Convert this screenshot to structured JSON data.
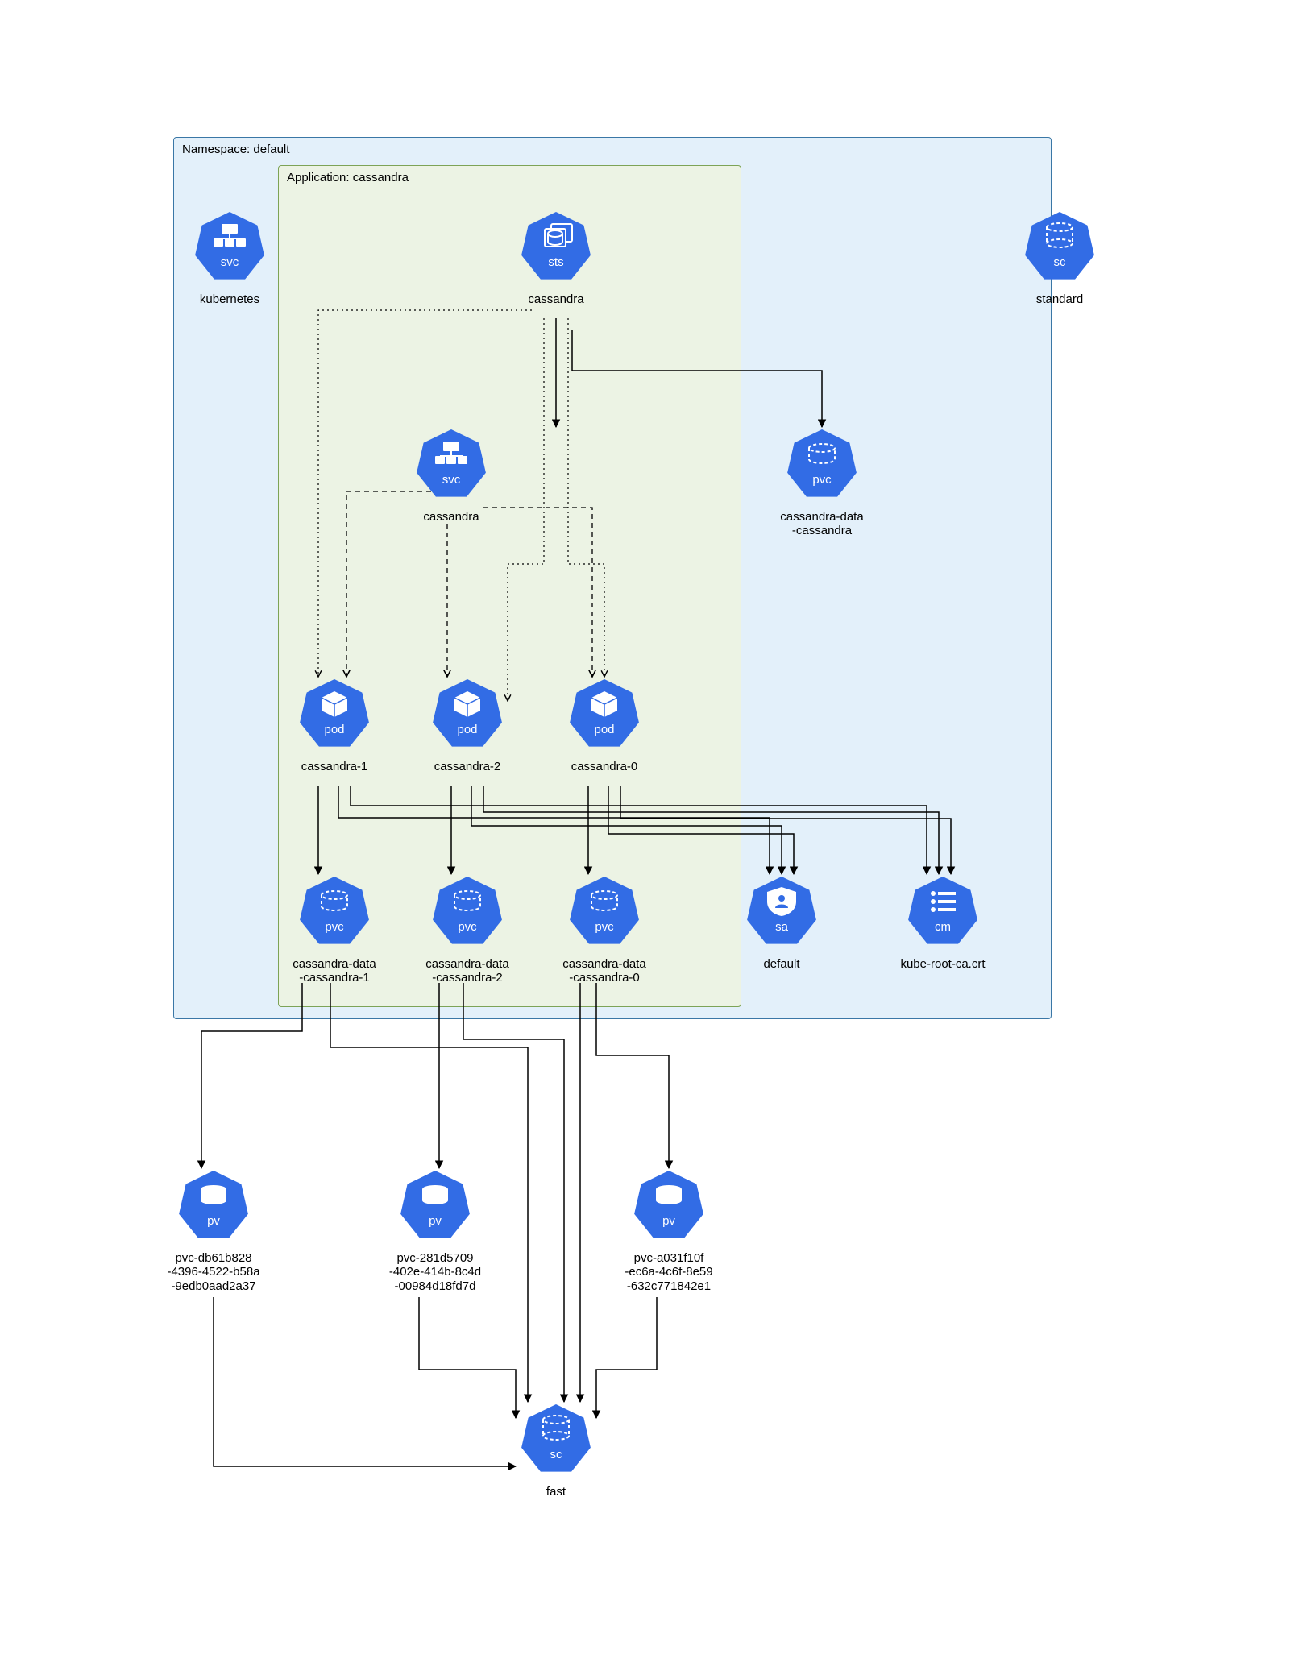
{
  "namespace_label": "Namespace: default",
  "application_label": "Application: cassandra",
  "nodes": {
    "svc_kubernetes": {
      "type": "svc",
      "label": "kubernetes"
    },
    "sts_cassandra": {
      "type": "sts",
      "label": "cassandra"
    },
    "sc_standard": {
      "type": "sc",
      "label": "standard"
    },
    "svc_cassandra": {
      "type": "svc",
      "label": "cassandra"
    },
    "pvc_cd": {
      "type": "pvc",
      "label": "cassandra-data\n-cassandra"
    },
    "pod_c1": {
      "type": "pod",
      "label": "cassandra-1"
    },
    "pod_c2": {
      "type": "pod",
      "label": "cassandra-2"
    },
    "pod_c0": {
      "type": "pod",
      "label": "cassandra-0"
    },
    "pvc_c1": {
      "type": "pvc",
      "label": "cassandra-data\n-cassandra-1"
    },
    "pvc_c2": {
      "type": "pvc",
      "label": "cassandra-data\n-cassandra-2"
    },
    "pvc_c0": {
      "type": "pvc",
      "label": "cassandra-data\n-cassandra-0"
    },
    "sa_default": {
      "type": "sa",
      "label": "default"
    },
    "cm_kube": {
      "type": "cm",
      "label": "kube-root-ca.crt"
    },
    "pv_1": {
      "type": "pv",
      "label": "pvc-db61b828\n-4396-4522-b58a\n-9edb0aad2a37"
    },
    "pv_2": {
      "type": "pv",
      "label": "pvc-281d5709\n-402e-414b-8c4d\n-00984d18fd7d"
    },
    "pv_0": {
      "type": "pv",
      "label": "pvc-a031f10f\n-ec6a-4c6f-8e59\n-632c771842e1"
    },
    "sc_fast": {
      "type": "sc",
      "label": "fast"
    }
  }
}
